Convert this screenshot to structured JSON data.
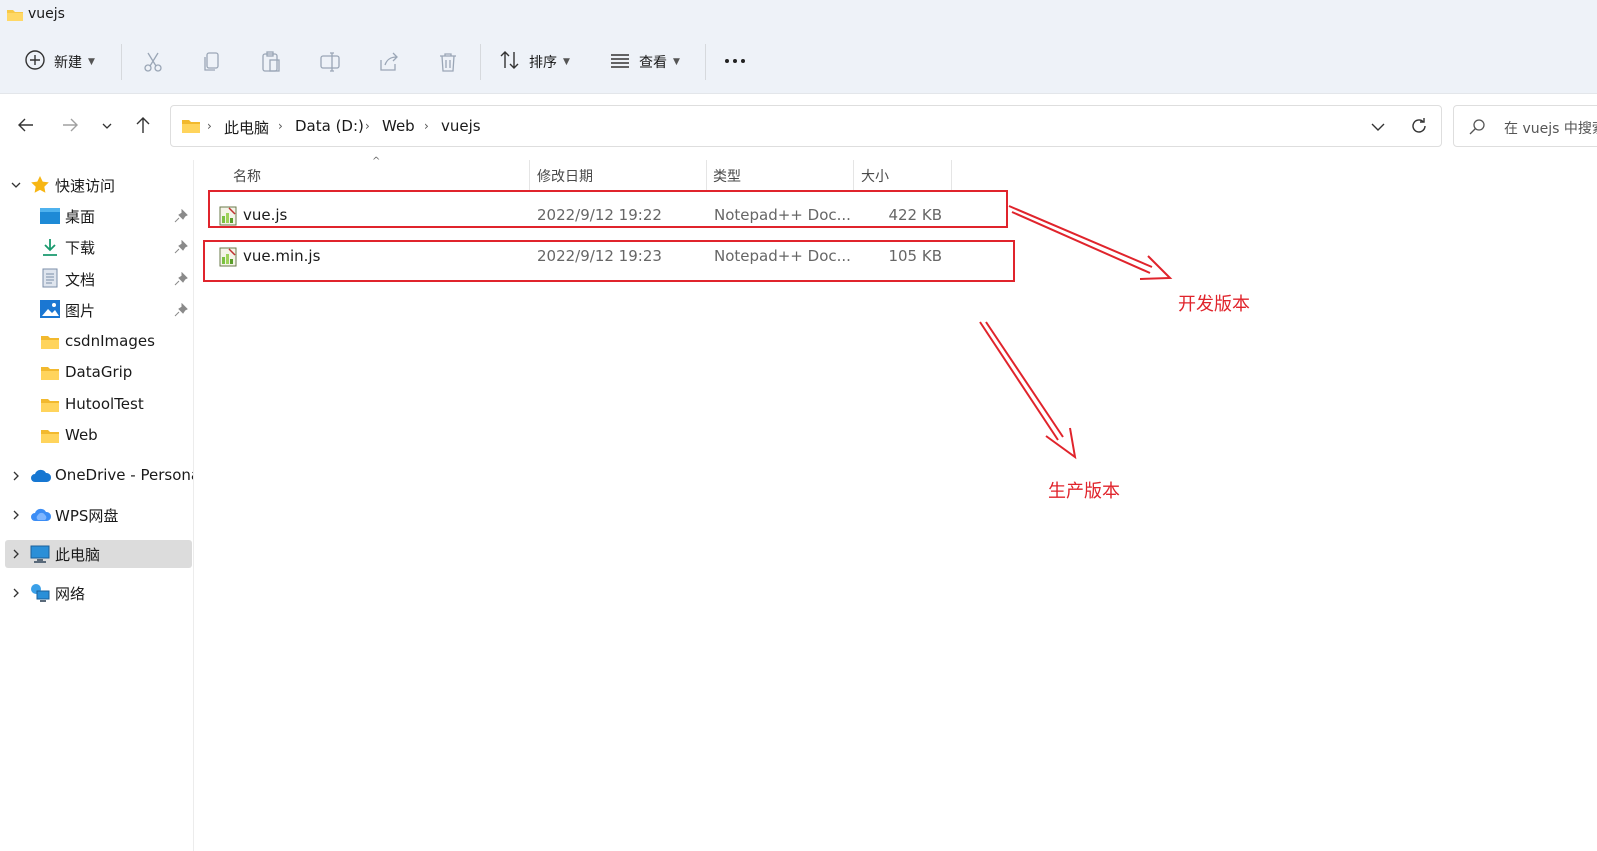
{
  "window": {
    "title": "vuejs"
  },
  "toolbar": {
    "new_label": "新建",
    "sort_label": "排序",
    "view_label": "查看",
    "more_label": "..."
  },
  "address": {
    "crumbs": [
      "此电脑",
      "Data (D:)",
      "Web",
      "vuejs"
    ],
    "search_placeholder": "在 vuejs 中搜索"
  },
  "sidebar": {
    "quick_access": "快速访问",
    "items": [
      {
        "label": "桌面",
        "icon": "desktop-icon",
        "pinned": true
      },
      {
        "label": "下载",
        "icon": "download-icon",
        "pinned": true
      },
      {
        "label": "文档",
        "icon": "document-icon",
        "pinned": true
      },
      {
        "label": "图片",
        "icon": "pictures-icon",
        "pinned": true
      },
      {
        "label": "csdnImages",
        "icon": "folder-icon",
        "pinned": false
      },
      {
        "label": "DataGrip",
        "icon": "folder-icon",
        "pinned": false
      },
      {
        "label": "HutoolTest",
        "icon": "folder-icon",
        "pinned": false
      },
      {
        "label": "Web",
        "icon": "folder-icon",
        "pinned": false
      }
    ],
    "onedrive": "OneDrive - Persona",
    "wps": "WPS网盘",
    "this_pc": "此电脑",
    "network": "网络"
  },
  "columns": {
    "name": "名称",
    "modified": "修改日期",
    "type": "类型",
    "size": "大小"
  },
  "files": [
    {
      "name": "vue.js",
      "modified": "2022/9/12 19:22",
      "type": "Notepad++ Doc...",
      "size": "422 KB"
    },
    {
      "name": "vue.min.js",
      "modified": "2022/9/12 19:23",
      "type": "Notepad++ Doc...",
      "size": "105 KB"
    }
  ],
  "annotations": {
    "dev_label": "开发版本",
    "prod_label": "生产版本",
    "color": "#e0242c"
  }
}
